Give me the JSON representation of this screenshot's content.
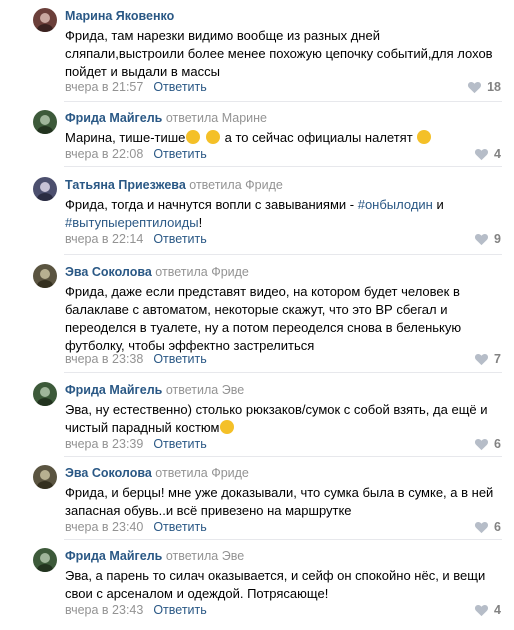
{
  "reply_word": "ответить",
  "comments": [
    {
      "author": "Марина Яковенко",
      "reply_to": "",
      "lines": [
        "Фрида, там нарезки видимо вообще из разных дней",
        "сляпали,выстроили более менее похожую цепочку событий,для лохов",
        "пойдет и выдали в массы"
      ],
      "date": "вчера в 21:57",
      "answer_label": "Ответить",
      "likes": "18",
      "avatar_colors": [
        "#6b3f3a",
        "#c9a8a0"
      ]
    },
    {
      "author": "Фрида Майгель",
      "reply_word": "ответила",
      "reply_to": "Марине",
      "lines": [
        "Марина, тише-тише",
        " а то сейчас официалы налетят"
      ],
      "date": "вчера в 22:08",
      "answer_label": "Ответить",
      "likes": "4",
      "avatar_colors": [
        "#3d5a3a",
        "#9fb59a"
      ]
    },
    {
      "author": "Татьяна Приезжева",
      "reply_word": "ответила",
      "reply_to": "Фриде",
      "line1": "Фрида, тогда и начнутся вопли с завываниями - ",
      "tag1": "#онбылодин",
      "line1_end": " и",
      "tag2": "#вытупыерептилоиды",
      "line2_end": "!",
      "date": "вчера в 22:14",
      "answer_label": "Ответить",
      "likes": "9",
      "avatar_colors": [
        "#4c4f6e",
        "#c7c2d6"
      ]
    },
    {
      "author": "Эва Соколова",
      "reply_word": "ответила",
      "reply_to": "Фриде",
      "lines": [
        "Фрида, даже если представят видео, на котором будет человек в",
        "балаклаве с автоматом, некоторые скажут, что это ВР сбегал и",
        "переоделся в туалете, ну а потом переоделся снова в беленькую",
        "футболку, чтобы эффектно застрелиться"
      ],
      "date": "вчера в 23:38",
      "answer_label": "Ответить",
      "likes": "7",
      "avatar_colors": [
        "#5a5440",
        "#b7b091"
      ]
    },
    {
      "author": "Фрида Майгель",
      "reply_word": "ответила",
      "reply_to": "Эве",
      "lines": [
        "Эва, ну естественно) столько рюкзаков/сумок с собой взять, да ещё и",
        "чистый парадный костюм"
      ],
      "date": "вчера в 23:39",
      "answer_label": "Ответить",
      "likes": "6",
      "avatar_colors": [
        "#3d5a3a",
        "#9fb59a"
      ]
    },
    {
      "author": "Эва Соколова",
      "reply_word": "ответила",
      "reply_to": "Фриде",
      "lines": [
        "Фрида, и берцы! мне уже доказывали, что сумка была в сумке, а в ней",
        "запасная обувь..и всё привезено на маршрутке"
      ],
      "date": "вчера в 23:40",
      "answer_label": "Ответить",
      "likes": "6",
      "avatar_colors": [
        "#5a5440",
        "#b7b091"
      ]
    },
    {
      "author": "Фрида Майгель",
      "reply_word": "ответила",
      "reply_to": "Эве",
      "lines": [
        "Эва, а парень то силач оказывается, и сейф он спокойно нёс, и вещи",
        "свои с арсеналом и одеждой. Потрясающе!"
      ],
      "date": "вчера в 23:43",
      "answer_label": "Ответить",
      "likes": "4",
      "avatar_colors": [
        "#3d5a3a",
        "#9fb59a"
      ]
    }
  ]
}
